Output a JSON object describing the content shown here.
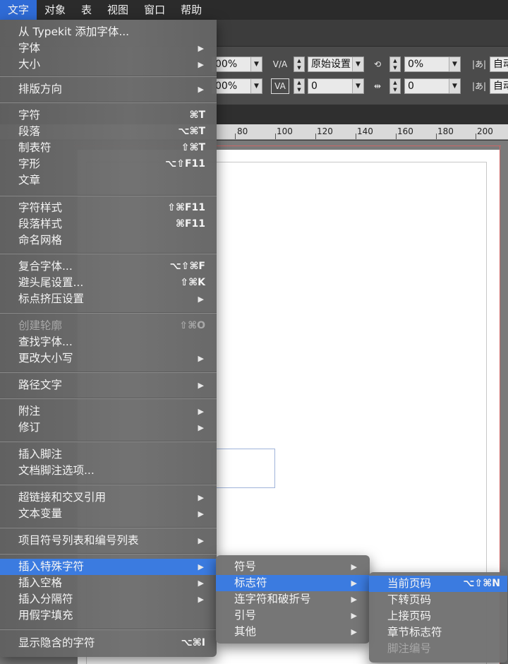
{
  "menubar": {
    "items": [
      "文字",
      "对象",
      "表",
      "视图",
      "窗口",
      "帮助"
    ],
    "active_index": 0
  },
  "toolbar": {
    "row1": {
      "field_a": "00%",
      "field_b": "原始设置",
      "field_c": "0%",
      "field_d": "自动"
    },
    "row2": {
      "field_a": "00%",
      "field_b": "0",
      "field_c": "0",
      "field_d": "自动"
    }
  },
  "ruler": {
    "labels": [
      "80",
      "100",
      "120",
      "140",
      "160",
      "180",
      "200"
    ]
  },
  "type_menu": {
    "groups": [
      [
        {
          "label": "从 Typekit 添加字体...",
          "shortcut": "",
          "submenu": false
        },
        {
          "label": "字体",
          "shortcut": "",
          "submenu": true
        },
        {
          "label": "大小",
          "shortcut": "",
          "submenu": true
        }
      ],
      [
        {
          "label": "排版方向",
          "shortcut": "",
          "submenu": true
        }
      ],
      [
        {
          "label": "字符",
          "shortcut": "⌘T",
          "submenu": false
        },
        {
          "label": "段落",
          "shortcut": "⌥⌘T",
          "submenu": false
        },
        {
          "label": "制表符",
          "shortcut": "⇧⌘T",
          "submenu": false
        },
        {
          "label": "字形",
          "shortcut": "⌥⇧F11",
          "submenu": false
        },
        {
          "label": "文章",
          "shortcut": "",
          "submenu": false
        }
      ],
      [
        {
          "label": "字符样式",
          "shortcut": "⇧⌘F11",
          "submenu": false
        },
        {
          "label": "段落样式",
          "shortcut": "⌘F11",
          "submenu": false
        },
        {
          "label": "命名网格",
          "shortcut": "",
          "submenu": false
        }
      ],
      [
        {
          "label": "复合字体...",
          "shortcut": "⌥⇧⌘F",
          "submenu": false
        },
        {
          "label": "避头尾设置...",
          "shortcut": "⇧⌘K",
          "submenu": false
        },
        {
          "label": "标点挤压设置",
          "shortcut": "",
          "submenu": true
        }
      ],
      [
        {
          "label": "创建轮廓",
          "shortcut": "⇧⌘O",
          "submenu": false,
          "disabled": true
        },
        {
          "label": "查找字体...",
          "shortcut": "",
          "submenu": false
        },
        {
          "label": "更改大小写",
          "shortcut": "",
          "submenu": true
        }
      ],
      [
        {
          "label": "路径文字",
          "shortcut": "",
          "submenu": true
        }
      ],
      [
        {
          "label": "附注",
          "shortcut": "",
          "submenu": true
        },
        {
          "label": "修订",
          "shortcut": "",
          "submenu": true
        }
      ],
      [
        {
          "label": "插入脚注",
          "shortcut": "",
          "submenu": false
        },
        {
          "label": "文档脚注选项...",
          "shortcut": "",
          "submenu": false
        }
      ],
      [
        {
          "label": "超链接和交叉引用",
          "shortcut": "",
          "submenu": true
        },
        {
          "label": "文本变量",
          "shortcut": "",
          "submenu": true
        }
      ],
      [
        {
          "label": "项目符号列表和编号列表",
          "shortcut": "",
          "submenu": true
        }
      ],
      [
        {
          "label": "插入特殊字符",
          "shortcut": "",
          "submenu": true,
          "highlighted": true
        },
        {
          "label": "插入空格",
          "shortcut": "",
          "submenu": true
        },
        {
          "label": "插入分隔符",
          "shortcut": "",
          "submenu": true
        },
        {
          "label": "用假字填充",
          "shortcut": "",
          "submenu": false
        }
      ],
      [
        {
          "label": "显示隐含的字符",
          "shortcut": "⌥⌘I",
          "submenu": false
        }
      ]
    ]
  },
  "special_char_menu": [
    {
      "label": "符号",
      "submenu": true
    },
    {
      "label": "标志符",
      "submenu": true,
      "highlighted": true
    },
    {
      "label": "连字符和破折号",
      "submenu": true
    },
    {
      "label": "引号",
      "submenu": true
    },
    {
      "label": "其他",
      "submenu": true
    }
  ],
  "marker_menu": [
    {
      "label": "当前页码",
      "shortcut": "⌥⇧⌘N",
      "highlighted": true
    },
    {
      "label": "下转页码",
      "shortcut": ""
    },
    {
      "label": "上接页码",
      "shortcut": ""
    },
    {
      "label": "章节标志符",
      "shortcut": ""
    },
    {
      "label": "脚注编号",
      "shortcut": "",
      "disabled": true
    }
  ],
  "icons": {
    "submenu_arrow": "▶"
  }
}
